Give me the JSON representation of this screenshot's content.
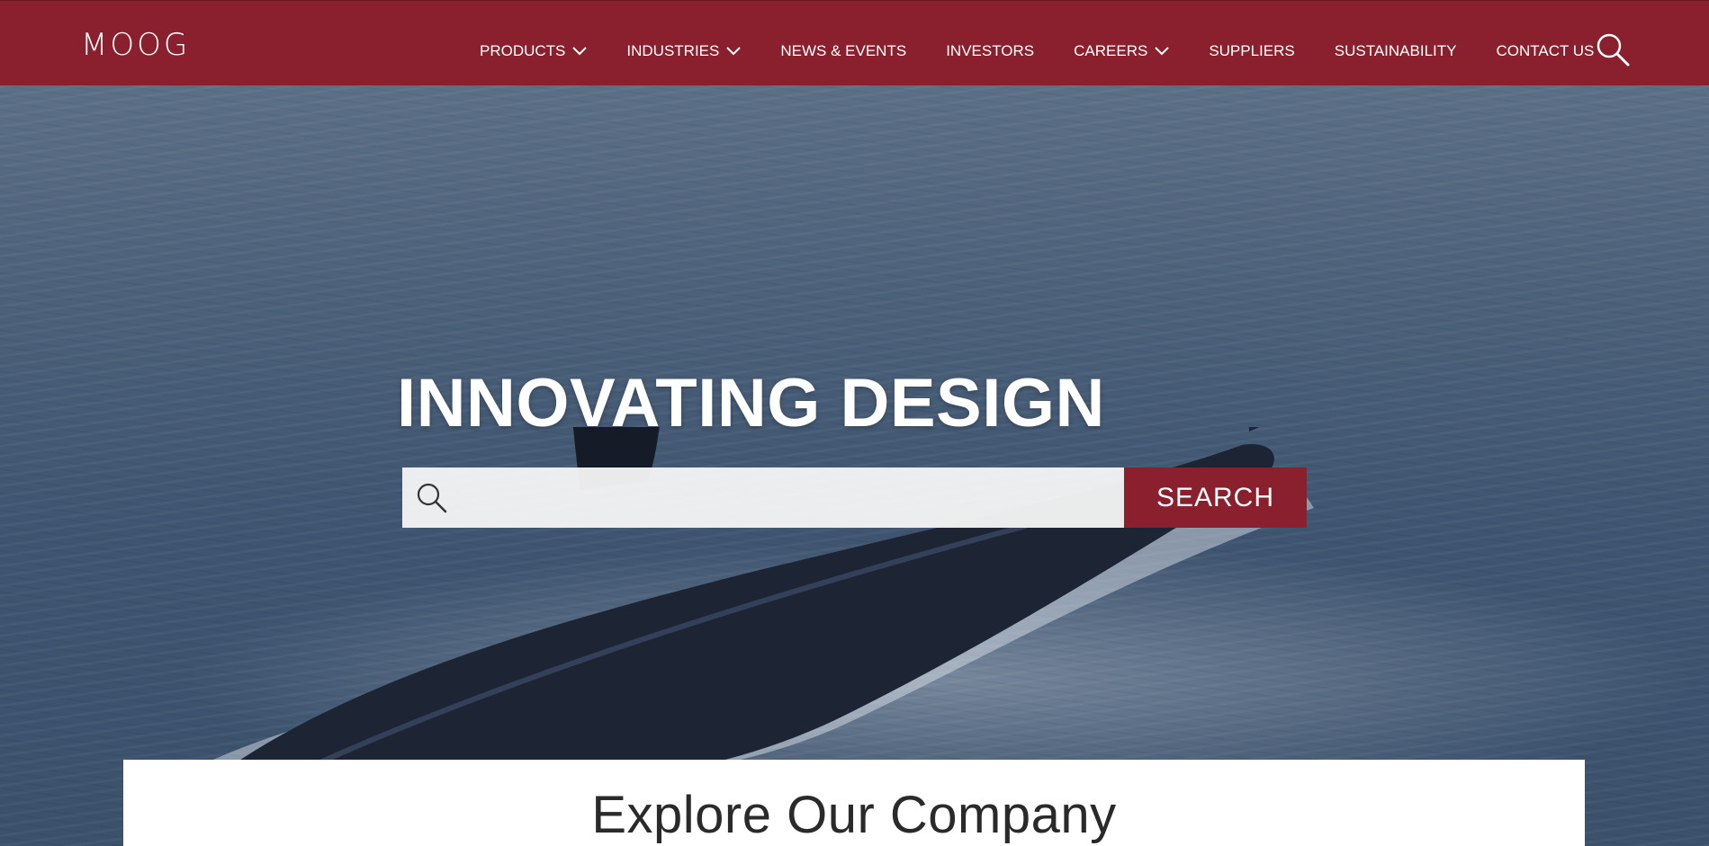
{
  "header": {
    "logo_text": "MOOG",
    "nav": [
      {
        "label": "PRODUCTS",
        "has_dropdown": true
      },
      {
        "label": "INDUSTRIES",
        "has_dropdown": true
      },
      {
        "label": "NEWS & EVENTS",
        "has_dropdown": false
      },
      {
        "label": "INVESTORS",
        "has_dropdown": false
      },
      {
        "label": "CAREERS",
        "has_dropdown": true
      },
      {
        "label": "SUPPLIERS",
        "has_dropdown": false
      },
      {
        "label": "SUSTAINABILITY",
        "has_dropdown": false
      },
      {
        "label": "CONTACT US",
        "has_dropdown": false
      }
    ],
    "search_icon": "search-icon"
  },
  "hero": {
    "title": "INNOVATING DESIGN",
    "search": {
      "placeholder": "",
      "value": "",
      "button_label": "SEARCH",
      "icon": "search-icon"
    },
    "background": "submarine-at-sea"
  },
  "explore": {
    "title": "Explore Our Company"
  },
  "colors": {
    "brand": "#8a1f2d",
    "text_light": "#ffffff",
    "panel": "#ffffff"
  }
}
